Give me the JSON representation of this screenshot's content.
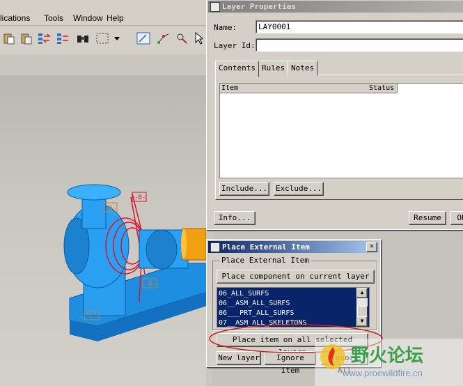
{
  "app": {
    "menu": [
      "lications",
      "Tools",
      "Window",
      "Help"
    ]
  },
  "toolbar_icons": [
    "paste-icon",
    "paste-special-icon",
    "regenerate-icon",
    "regenerate-manager-icon",
    "binoculars-icon",
    "select-box-icon",
    "dropdown-arrow-icon",
    "sketch-icon",
    "datum-icon",
    "analysis-icon",
    "cursor-icon"
  ],
  "viewport": {
    "annotations": [
      "-B-",
      "-B-",
      "-B-",
      "-C-"
    ]
  },
  "layer_properties": {
    "title": "Layer Properties",
    "name_label": "Name:",
    "name_value": "LAY0001",
    "layer_id_label": "Layer Id:",
    "layer_id_value": "",
    "tabs": [
      "Contents",
      "Rules",
      "Notes"
    ],
    "columns": [
      "Item",
      "Status"
    ],
    "include_button": "Include...",
    "exclude_button": "Exclude...",
    "info_button": "Info...",
    "resume_button": "Resume",
    "ok_button": "OK"
  },
  "place_external": {
    "title": "Place External Item",
    "group_label": "Place External Item",
    "place_component_button": "Place component on current layer",
    "layers": [
      "06_ALL_SURFS",
      "06__ASM_ALL_SURFS",
      "06___PRT_ALL_SURFS",
      "07__ASM_ALL_SKELETONS"
    ],
    "place_all_button": "Place item on all selected  layers",
    "new_layer_button": "New layer",
    "ignore_item_button": "Ignore item",
    "ignore_all_button": "Ignore All",
    "close_glyph": "✕"
  },
  "watermark": {
    "site_cn": "野火论坛",
    "url": "www.proewildfire.cn"
  }
}
